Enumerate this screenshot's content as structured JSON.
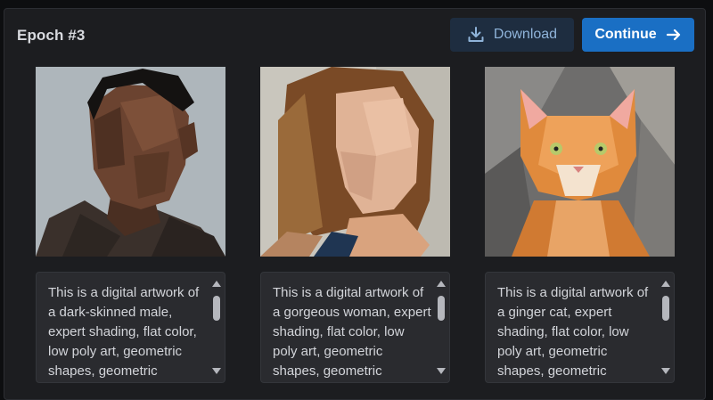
{
  "header": {
    "title": "Epoch #3",
    "download_label": "Download",
    "continue_label": "Continue"
  },
  "cards": [
    {
      "image_icon": "portrait-man-lowpoly-image",
      "caption": "This is a digital artwork of a dark-skinned male, expert shading, flat color, low poly art, geometric shapes, geometric"
    },
    {
      "image_icon": "portrait-woman-lowpoly-image",
      "caption": "This is a digital artwork of a gorgeous woman, expert shading, flat color, low poly art, geometric shapes, geometric"
    },
    {
      "image_icon": "ginger-cat-lowpoly-image",
      "caption": "This is a digital artwork of a ginger cat, expert shading, flat color, low poly art, geometric shapes, geometric"
    }
  ],
  "colors": {
    "panel_bg": "#1c1d20",
    "download_bg": "#1e2d40",
    "continue_bg": "#1a6fc4"
  }
}
